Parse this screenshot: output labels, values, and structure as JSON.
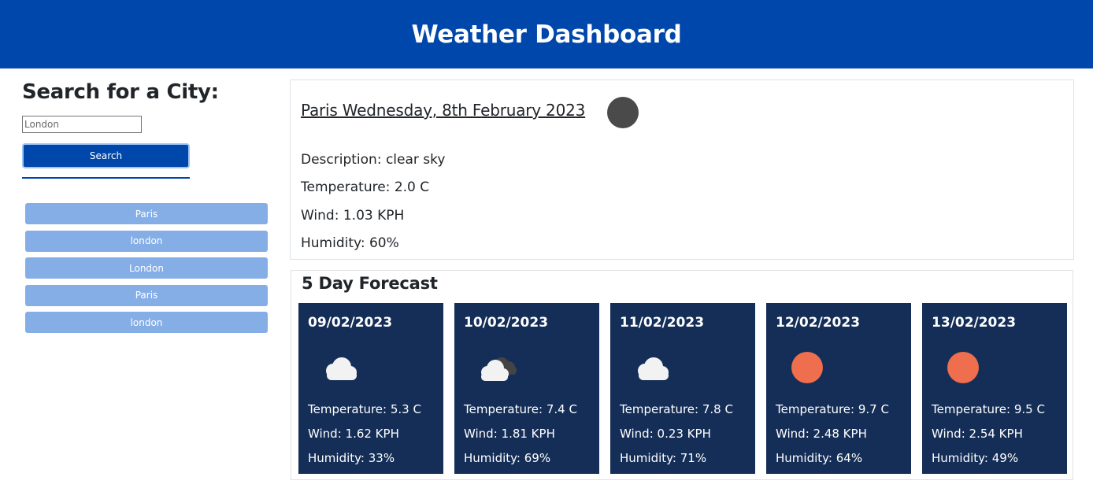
{
  "header": {
    "title": "Weather Dashboard"
  },
  "sidebar": {
    "heading": "Search for a City:",
    "search": {
      "value": "",
      "placeholder": "London"
    },
    "search_button": "Search",
    "history": [
      "Paris",
      "london",
      "London",
      "Paris",
      "london"
    ]
  },
  "current": {
    "title": "Paris Wednesday, 8th February 2023",
    "icon": "clear-sky-icon",
    "description": "Description: clear sky",
    "temperature": "Temperature: 2.0 C",
    "wind": "Wind: 1.03 KPH",
    "humidity": "Humidity: 60%"
  },
  "forecast": {
    "heading": "5 Day Forecast",
    "days": [
      {
        "date": "09/02/2023",
        "icon": "cloud-icon",
        "temperature": "Temperature: 5.3 C",
        "wind": "Wind: 1.62 KPH",
        "humidity": "Humidity: 33%"
      },
      {
        "date": "10/02/2023",
        "icon": "broken-clouds-icon",
        "temperature": "Temperature: 7.4 C",
        "wind": "Wind: 1.81 KPH",
        "humidity": "Humidity: 69%"
      },
      {
        "date": "11/02/2023",
        "icon": "cloud-icon",
        "temperature": "Temperature: 7.8 C",
        "wind": "Wind: 0.23 KPH",
        "humidity": "Humidity: 71%"
      },
      {
        "date": "12/02/2023",
        "icon": "sun-icon",
        "temperature": "Temperature: 9.7 C",
        "wind": "Wind: 2.48 KPH",
        "humidity": "Humidity: 64%"
      },
      {
        "date": "13/02/2023",
        "icon": "sun-icon",
        "temperature": "Temperature: 9.5 C",
        "wind": "Wind: 2.54 KPH",
        "humidity": "Humidity: 49%"
      }
    ]
  },
  "colors": {
    "header": "#0047ab",
    "history_button": "#86aee6",
    "forecast_card": "#152e57",
    "sun": "#ee6e4e",
    "current_icon": "#4a4a4a"
  }
}
